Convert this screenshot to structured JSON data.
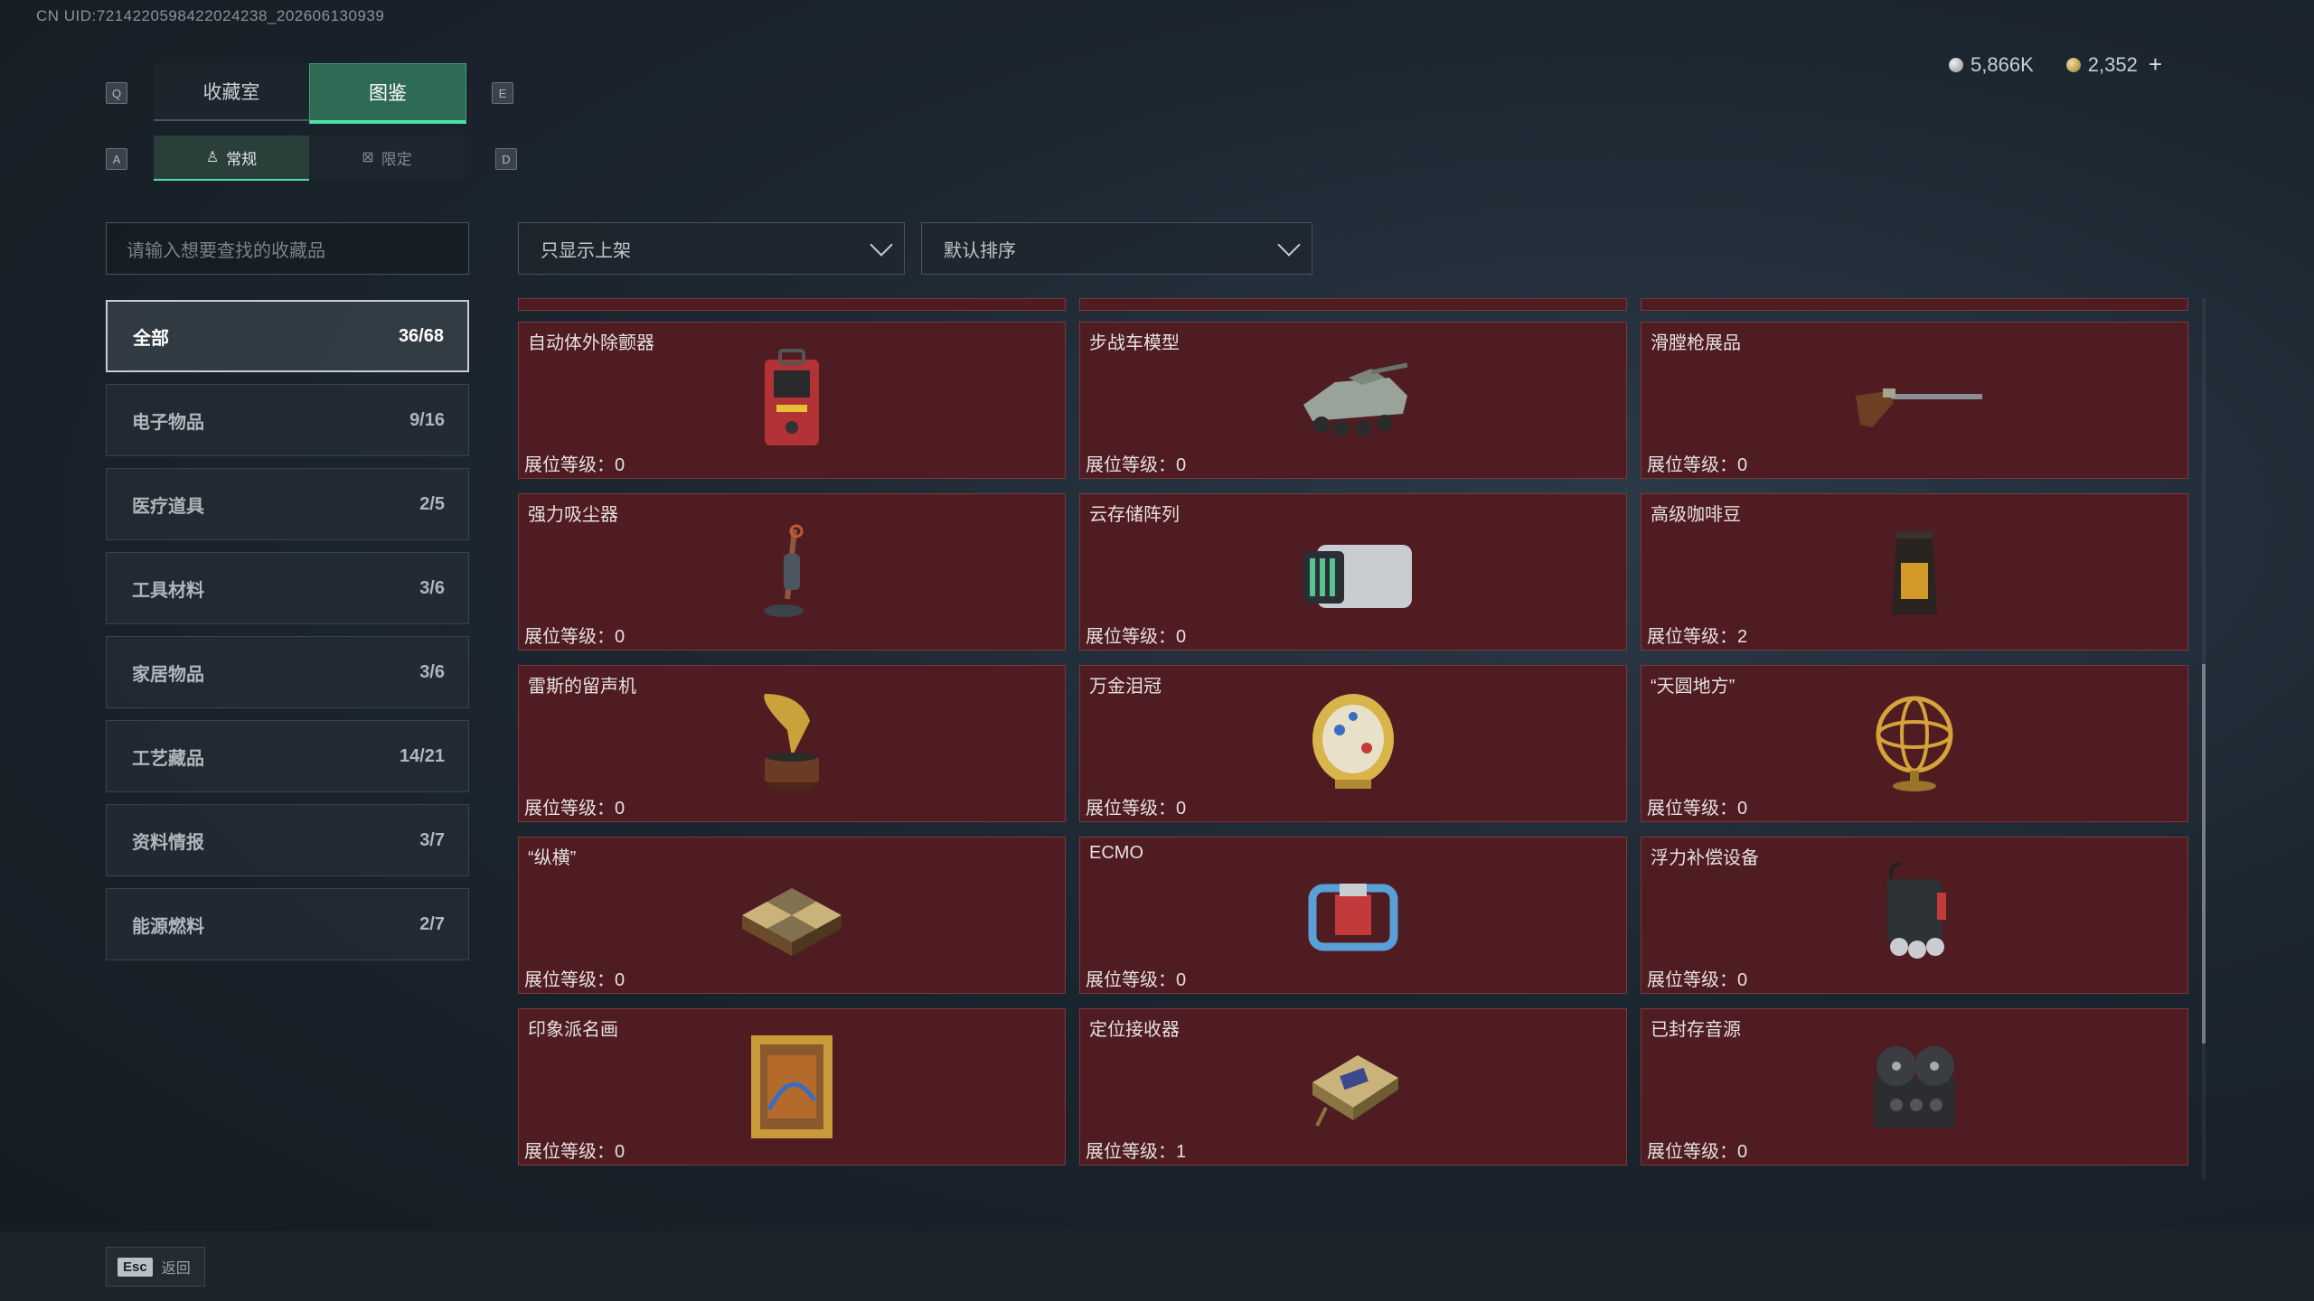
{
  "uid": "CN UID:7214220598422024238_202606130939",
  "currency": {
    "silver": "5,866K",
    "gold": "2,352",
    "plus": "+"
  },
  "keys": {
    "q": "Q",
    "e": "E",
    "a": "A",
    "d": "D"
  },
  "tabs": [
    {
      "label": "收藏室"
    },
    {
      "label": "图鉴"
    }
  ],
  "subtabs": [
    {
      "label": "常规",
      "icon": "♙"
    },
    {
      "label": "限定",
      "icon": "⊠"
    }
  ],
  "search": {
    "placeholder": "请输入想要查找的收藏品"
  },
  "filters": {
    "shelf": "只显示上架",
    "sort": "默认排序"
  },
  "categories": [
    {
      "name": "全部",
      "count": "36/68"
    },
    {
      "name": "电子物品",
      "count": "9/16"
    },
    {
      "name": "医疗道具",
      "count": "2/5"
    },
    {
      "name": "工具材料",
      "count": "3/6"
    },
    {
      "name": "家居物品",
      "count": "3/6"
    },
    {
      "name": "工艺藏品",
      "count": "14/21"
    },
    {
      "name": "资料情报",
      "count": "3/7"
    },
    {
      "name": "能源燃料",
      "count": "2/7"
    }
  ],
  "level_label": "展位等级：",
  "items": [
    {
      "name": "自动体外除颤器",
      "level": "0",
      "icon": "defibrillator-icon"
    },
    {
      "name": "步战车模型",
      "level": "0",
      "icon": "ifv-model-icon"
    },
    {
      "name": "滑膛枪展品",
      "level": "0",
      "icon": "musket-icon"
    },
    {
      "name": "强力吸尘器",
      "level": "0",
      "icon": "vacuum-icon"
    },
    {
      "name": "云存储阵列",
      "level": "0",
      "icon": "storage-array-icon"
    },
    {
      "name": "高级咖啡豆",
      "level": "2",
      "icon": "coffee-bag-icon"
    },
    {
      "name": "雷斯的留声机",
      "level": "0",
      "icon": "gramophone-icon"
    },
    {
      "name": "万金泪冠",
      "level": "0",
      "icon": "jeweled-egg-icon"
    },
    {
      "name": "“天圆地方”",
      "level": "0",
      "icon": "armillary-sphere-icon"
    },
    {
      "name": "“纵横”",
      "level": "0",
      "icon": "chessboard-icon"
    },
    {
      "name": "ECMO",
      "level": "0",
      "icon": "ecmo-machine-icon"
    },
    {
      "name": "浮力补偿设备",
      "level": "0",
      "icon": "bcd-device-icon"
    },
    {
      "name": "印象派名画",
      "level": "0",
      "icon": "framed-painting-icon"
    },
    {
      "name": "定位接收器",
      "level": "1",
      "icon": "gps-receiver-icon"
    },
    {
      "name": "已封存音源",
      "level": "0",
      "icon": "reel-recorder-icon"
    }
  ],
  "footer": {
    "esc_key": "Esc",
    "esc_label": "返回"
  },
  "colors": {
    "accent": "#4fe0a6",
    "card_bg": "#4f1c22",
    "card_border": "#7a3840"
  }
}
